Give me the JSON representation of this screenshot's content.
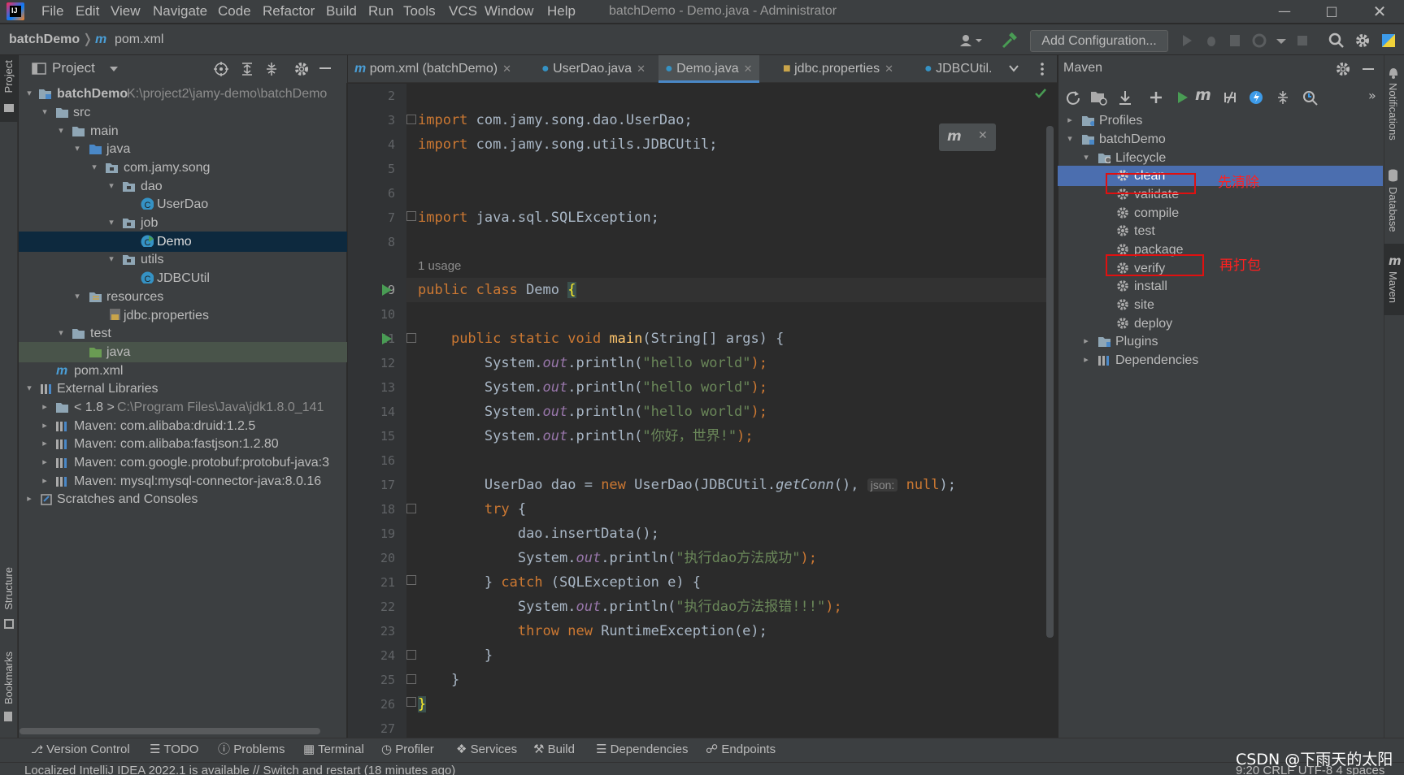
{
  "window": {
    "title": "batchDemo - Demo.java - Administrator",
    "menu": [
      "File",
      "Edit",
      "View",
      "Navigate",
      "Code",
      "Refactor",
      "Build",
      "Run",
      "Tools",
      "VCS",
      "Window",
      "Help"
    ]
  },
  "navbar": {
    "breadcrumb_project": "batchDemo",
    "breadcrumb_file": "pom.xml",
    "add_configuration": "Add Configuration..."
  },
  "left_stripe": {
    "project": "Project",
    "structure": "Structure",
    "bookmarks": "Bookmarks"
  },
  "project_panel": {
    "title": "Project",
    "tree": [
      {
        "label": "batchDemo",
        "path": "K:\\project2\\jamy-demo\\batchDemo"
      },
      {
        "label": "src"
      },
      {
        "label": "main"
      },
      {
        "label": "java"
      },
      {
        "label": "com.jamy.song"
      },
      {
        "label": "dao"
      },
      {
        "label": "UserDao"
      },
      {
        "label": "job"
      },
      {
        "label": "Demo"
      },
      {
        "label": "utils"
      },
      {
        "label": "JDBCUtil"
      },
      {
        "label": "resources"
      },
      {
        "label": "jdbc.properties"
      },
      {
        "label": "test"
      },
      {
        "label": "java"
      },
      {
        "label": "pom.xml"
      },
      {
        "label": "External Libraries"
      },
      {
        "label": "< 1.8 >",
        "path": "C:\\Program Files\\Java\\jdk1.8.0_141"
      },
      {
        "label": "Maven: com.alibaba:druid:1.2.5"
      },
      {
        "label": "Maven: com.alibaba:fastjson:1.2.80"
      },
      {
        "label": "Maven: com.google.protobuf:protobuf-java:3"
      },
      {
        "label": "Maven: mysql:mysql-connector-java:8.0.16"
      },
      {
        "label": "Scratches and Consoles"
      }
    ]
  },
  "editor": {
    "tabs": [
      {
        "label": "pom.xml (batchDemo)"
      },
      {
        "label": "UserDao.java"
      },
      {
        "label": "Demo.java"
      },
      {
        "label": "jdbc.properties"
      },
      {
        "label": "JDBCUtil."
      }
    ],
    "line_numbers": [
      "2",
      "3",
      "4",
      "5",
      "6",
      "7",
      "8",
      "9",
      "10",
      "11",
      "12",
      "13",
      "14",
      "15",
      "16",
      "17",
      "18",
      "19",
      "20",
      "21",
      "22",
      "23",
      "24",
      "25",
      "26",
      "27"
    ],
    "usage_hint": "1 usage",
    "param_hint": "json:",
    "code": {
      "l3": [
        "import",
        " com.jamy.song.dao.UserDao;"
      ],
      "l4": [
        "import",
        " com.jamy.song.utils.JDBCUtil;"
      ],
      "l7": [
        "import",
        " java.sql.SQLException;"
      ],
      "l9": [
        "public class",
        " Demo ",
        "{"
      ],
      "l11": [
        "public static void",
        " ",
        "main",
        "(String[] args) {"
      ],
      "println": [
        "System.",
        "out",
        ".println("
      ],
      "hello": "\"hello world\"",
      "nihao": "\"你好，世界!\"",
      "l17": [
        "UserDao dao = ",
        "new",
        " UserDao(JDBCUtil.",
        "getConn",
        "(), ",
        "null",
        ");"
      ],
      "l18": [
        "try",
        " {"
      ],
      "l19": "dao.insertData();",
      "l20str": "\"执行dao方法成功\"",
      "l21": [
        "} ",
        "catch",
        " (SQLException e) {"
      ],
      "l22str": "\"执行dao方法报错!!!\"",
      "l23": [
        "throw new",
        " RuntimeException(e);"
      ],
      "close_paren": ");",
      "brace": "}"
    }
  },
  "maven_panel": {
    "title": "Maven",
    "profiles": "Profiles",
    "project": "batchDemo",
    "lifecycle": "Lifecycle",
    "phases": [
      "clean",
      "validate",
      "compile",
      "test",
      "package",
      "verify",
      "install",
      "site",
      "deploy"
    ],
    "plugins": "Plugins",
    "dependencies": "Dependencies",
    "annotation_clean": "先清除",
    "annotation_package": "再打包"
  },
  "right_stripe": {
    "notifications": "Notifications",
    "database": "Database",
    "maven": "Maven"
  },
  "bottom_tools": [
    "Version Control",
    "TODO",
    "Problems",
    "Terminal",
    "Profiler",
    "Services",
    "Build",
    "Dependencies",
    "Endpoints"
  ],
  "status": {
    "message": "Localized IntelliJ IDEA 2022.1 is available // Switch and restart (18 minutes ago)",
    "right": "9:20   CRLF   UTF-8   4 spaces"
  },
  "watermark": "CSDN @下雨天的太阳"
}
